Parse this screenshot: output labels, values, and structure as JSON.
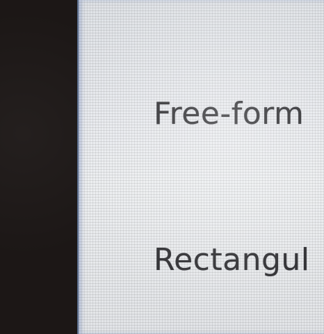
{
  "menu": {
    "items": [
      {
        "label": "Free-form"
      },
      {
        "label": "Rectangul"
      }
    ]
  }
}
